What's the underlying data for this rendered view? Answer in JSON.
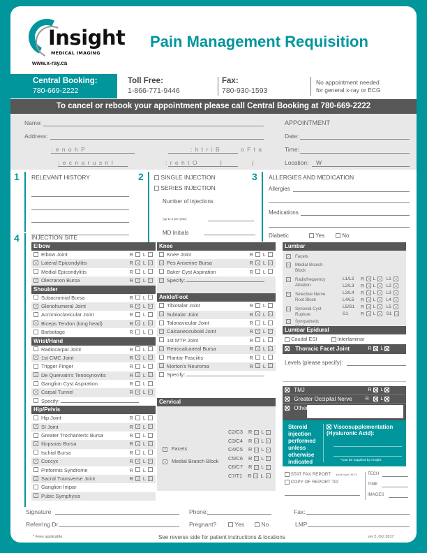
{
  "header": {
    "logo_name": "Insight",
    "logo_sub": "MEDICAL IMAGING",
    "url": "www.x-ray.ca",
    "title": "Pain Management Requisition"
  },
  "contacts": {
    "central_booking": {
      "label": "Central Booking:",
      "value": "780-669-2222"
    },
    "toll_free": {
      "label": "Toll Free:",
      "value": "1-866-771-9446"
    },
    "fax": {
      "label": "Fax:",
      "value": "780-930-1593"
    },
    "note_line1": "No appointment needed",
    "note_line2": "for general x-ray or ECG"
  },
  "cancel_banner": "To cancel or rebook your appointment please call Central Booking at 780-669-2222",
  "patient": {
    "name_label": "Name:",
    "address_label": "Address:",
    "phone_label_rendered": ": e n o h P",
    "birth_label_rendered": ": h t r i B",
    "date_of_rendered": "o F   t a",
    "insurance_label_rendered": ": e c n a r u s n I",
    "other_label_rendered": ": r e h t O",
    "paren_open": "(",
    "paren_close": ")",
    "w_text": "W",
    "appointment_heading": "APPOINTMENT",
    "date_label": "Date:",
    "time_label": "Time:",
    "location_label": "Location:"
  },
  "sections": {
    "s1": {
      "number": "1",
      "title": "RELEVANT HISTORY"
    },
    "s2": {
      "number": "2",
      "single": "SINGLE INJECTION",
      "series": "SERIES INJECTION",
      "num_injections": "Number of injections",
      "num_note": "(up to 4 per year)",
      "md_initials": "MD Initials"
    },
    "s3": {
      "number": "3",
      "title": "ALLERGIES AND MEDICATION",
      "allergies": "Allergies",
      "medications": "Medications",
      "diabetic": "Diabetic",
      "yes": "Yes",
      "no": "No"
    },
    "s4": {
      "number": "4",
      "title": "INJECTION SITE"
    }
  },
  "col1": [
    {
      "title": "Elbow",
      "rows": [
        {
          "label": "Elbow Joint",
          "rl": true
        },
        {
          "label": "Lateral Epicondylitis",
          "rl": true
        },
        {
          "label": "Medial Epicondylitis",
          "rl": true
        },
        {
          "label": "Olecranon Bursa",
          "rl": true
        }
      ]
    },
    {
      "title": "Shoulder",
      "rows": [
        {
          "label": "Subacromial Bursa",
          "rl": true
        },
        {
          "label": "Glenohumeral Joint",
          "rl": true
        },
        {
          "label": "Acromioclavicular Joint",
          "rl": true
        },
        {
          "label": "Biceps Tendon (long head)",
          "rl": true
        },
        {
          "label": "Barbotage",
          "rl": true
        }
      ]
    },
    {
      "title": "Wrist/Hand",
      "rows": [
        {
          "label": "Radiocarpal Joint",
          "rl": true
        },
        {
          "label": "1st CMC Joint",
          "rl": true
        },
        {
          "label": "Trigger Finger",
          "rl": true
        },
        {
          "label": "De Quervain's Tenosynovitis",
          "rl": true
        },
        {
          "label": "Ganglion Cyst Aspiration",
          "rl": true
        },
        {
          "label": "Carpal Tunnel",
          "rl": true
        },
        {
          "label": "Specify:",
          "rl": false,
          "line": true
        }
      ]
    },
    {
      "title": "Hip/Pelvis",
      "rows": [
        {
          "label": "Hip Joint",
          "rl": true
        },
        {
          "label": "SI Joint",
          "rl": true
        },
        {
          "label": "Greater Trochanteric Bursa",
          "rl": true
        },
        {
          "label": "Iliopsoas Bursa",
          "rl": true
        },
        {
          "label": "Ischial Bursa",
          "rl": true
        },
        {
          "label": "Coccyx",
          "rl": true
        },
        {
          "label": "Piriformis Syndrome",
          "rl": true
        },
        {
          "label": "Sacral Transverse Joint",
          "rl": true
        },
        {
          "label": "Ganglion Impar",
          "rl": false
        },
        {
          "label": "Pubic Symphysis",
          "rl": false
        }
      ]
    }
  ],
  "col2": [
    {
      "title": "Knee",
      "rows": [
        {
          "label": "Knee Joint",
          "rl": true
        },
        {
          "label": "Pes Anserine Bursa",
          "rl": true
        },
        {
          "label": "Baker Cyst Aspiration",
          "rl": true
        },
        {
          "label": "Specify:",
          "rl": false,
          "line": true
        }
      ]
    },
    {
      "title": "Ankle/Foot",
      "rows": [
        {
          "label": "Tibiotalar Joint",
          "rl": true
        },
        {
          "label": "Subtalar Joint",
          "rl": true
        },
        {
          "label": "Talonavicular Joint",
          "rl": true
        },
        {
          "label": "Calcaneocuboid Joint",
          "rl": true
        },
        {
          "label": "1st MTP Joint",
          "rl": true
        },
        {
          "label": "Retrocalcaneal Bursa",
          "rl": true
        },
        {
          "label": "Plantar Fasciitis",
          "rl": true
        },
        {
          "label": "Morton's Neuroma",
          "rl": true
        },
        {
          "label": "Specify:",
          "rl": false,
          "line": true
        }
      ]
    }
  ],
  "cervical": {
    "title": "Cervical",
    "options": [
      "Facets",
      "Medial Branch Block"
    ],
    "levels": [
      "C2/C3",
      "C3/C4",
      "C4/C5",
      "C5/C6",
      "C6/C7",
      "C7/T1"
    ]
  },
  "lumbar": {
    "title": "Lumbar",
    "options": [
      "Facets",
      "Medial Branch Block",
      "Radiofrequency Ablation",
      "Selective Nerve Root Block",
      "Synovial Cyst Rupture",
      "Sympathetic Block"
    ],
    "levels": [
      "L1/L2",
      "L2/L3",
      "L3/L4",
      "L4/L5",
      "L5/S1",
      "S1"
    ],
    "roots": [
      "L1",
      "L2",
      "L3",
      "L4",
      "L5",
      "S1"
    ]
  },
  "lumbar_epidural": {
    "title": "Lumbar Epidural",
    "caudal": "Caudal ESI",
    "interlaminar": "Interlaminar"
  },
  "thoracic": {
    "title": "Thoracic Facet Joint",
    "levels_label": "Levels (please specify):"
  },
  "other_sites": {
    "tmj": "TMJ",
    "gon": "Greater Occipital Nerve",
    "other": "Other"
  },
  "rl_labels": {
    "r": "R",
    "l": "L"
  },
  "steroid_box": {
    "steroid_text": "Steroid injection performed unless otherwise indicated",
    "visco": "Viscosupplementation (Hyaluronic Acid):",
    "supplied_note": "*Can be supplied by Insight"
  },
  "report": {
    "stat_fax": "STAT FAX REPORT",
    "stat_note": "(until 4 pm, M-F)",
    "copy_to": "COPY OF REPORT TO:",
    "tech": "TECH",
    "time": "TIME",
    "images": "IMAGES"
  },
  "footer": {
    "signature": "Signature",
    "phone": "Phone:",
    "fax": "Fax:",
    "referring": "Referring Dr.",
    "pregnant": "Pregnant?",
    "yes": "Yes",
    "no": "No",
    "lmp": "LMP",
    "fees": "* Fees applicable.",
    "reverse": "See reverse side for patient instructions & locations",
    "version": "ver 2, Oct 2017"
  }
}
